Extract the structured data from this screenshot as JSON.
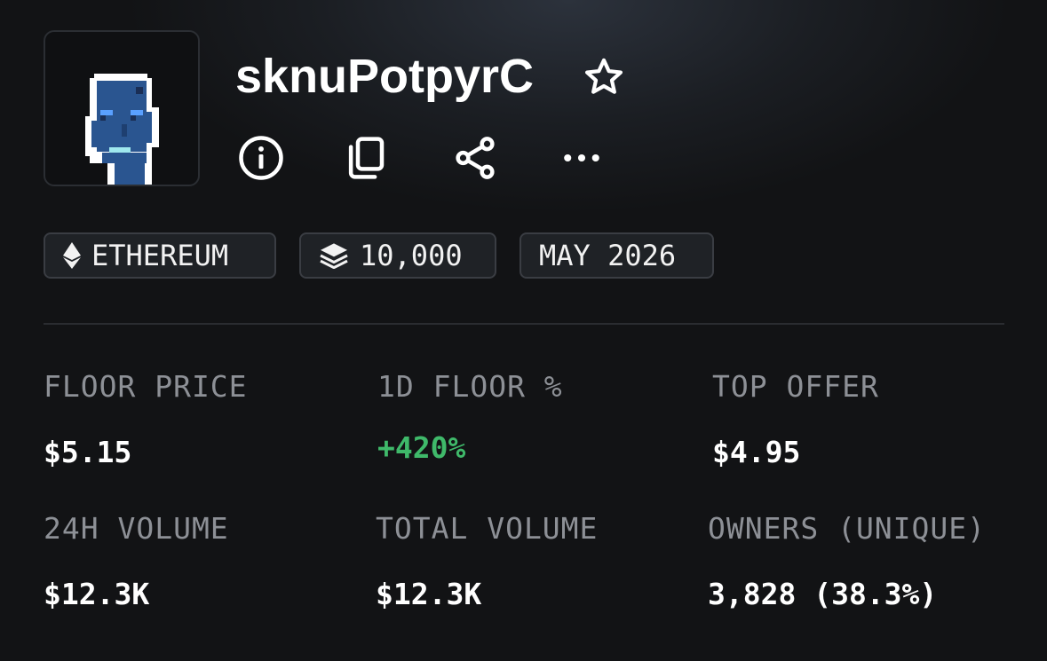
{
  "collection": {
    "name": "sknuPotpyrC"
  },
  "chips": {
    "chain": "ETHEREUM",
    "supply": "10,000",
    "date": "MAY 2026"
  },
  "stats": [
    {
      "label": "FLOOR PRICE",
      "value": "$5.15"
    },
    {
      "label": "1D FLOOR %",
      "value": "+420%"
    },
    {
      "label": "TOP OFFER",
      "value": "$4.95"
    },
    {
      "label": "24H VOLUME",
      "value": "$12.3K"
    },
    {
      "label": "TOTAL VOLUME",
      "value": "$12.3K"
    },
    {
      "label": "OWNERS (UNIQUE)",
      "value": "3,828 (38.3%)"
    }
  ],
  "colors": {
    "positive": "#3fb96a",
    "avatar_skin": "#2a5590",
    "avatar_eye": "#5aa0ff",
    "avatar_mouth": "#9fe8ee"
  },
  "icons": {
    "favorite": "star-icon",
    "info": "info-icon",
    "copy": "copy-icon",
    "share": "share-icon",
    "more": "more-icon",
    "chain": "ethereum-icon",
    "supply": "layers-icon"
  }
}
